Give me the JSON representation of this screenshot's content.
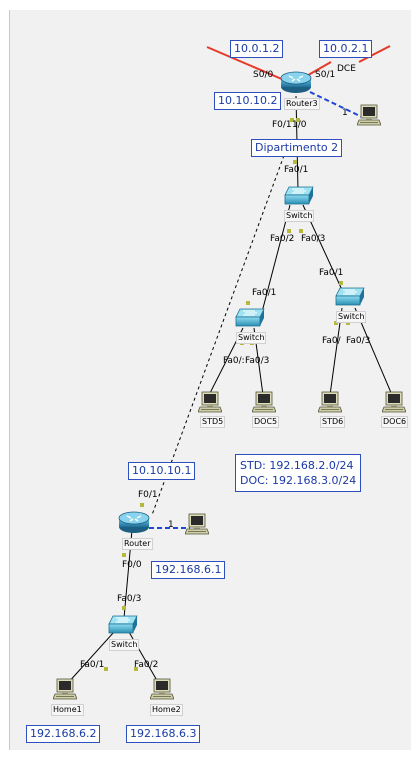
{
  "devices": {
    "router3": {
      "name": "Router3"
    },
    "router": {
      "name": "Router"
    },
    "switch_d2": {
      "name": "Switch"
    },
    "switch_left": {
      "name": "Switch"
    },
    "switch_right": {
      "name": "Switch"
    },
    "switch_bottom": {
      "name": "Switch"
    },
    "pc_r3": {
      "name": ""
    },
    "pc_router": {
      "name": ""
    },
    "std5": {
      "name": "STD5"
    },
    "doc5": {
      "name": "DOC5"
    },
    "std6": {
      "name": "STD6"
    },
    "doc6": {
      "name": "DOC6"
    },
    "home1": {
      "name": "Home1"
    },
    "home2": {
      "name": "Home2"
    }
  },
  "notes": {
    "ip_r3_s00": "10.0.1.2",
    "ip_r3_s01": "10.0.2.1",
    "ip_r3_f01": "10.10.10.2",
    "dept": "Dipartimento 2",
    "ip_router_f01": "10.10.10.1",
    "ip_router_f00": "192.168.6.1",
    "vlan_std": "STD: 192.168.2.0/24",
    "vlan_doc": "DOC: 192.168.3.0/24",
    "ip_home1": "192.168.6.2",
    "ip_home2": "192.168.6.3"
  },
  "ports": {
    "r3_s00": "S0/0",
    "r3_s01": "S0/1",
    "r3_dce": "DCE",
    "r3_f01": "F0/1",
    "r3_f10": "1/0",
    "r3_console": "1",
    "sw_d2_up": "Fa0/1",
    "sw_d2_left": "Fa0/2",
    "sw_d2_right": "Fa0/3",
    "swl_up": "Fa0/1",
    "swl_left": "Fa0/:",
    "swl_right": "Fa0/3",
    "swr_up": "Fa0/1",
    "swr_left": "Fa0/",
    "swr_right": "Fa0/3",
    "router_f01": "F0/1",
    "router_console": "1",
    "router_f00": "F0/0",
    "swb_up": "Fa0/3",
    "swb_left": "Fa0/1",
    "swb_right": "Fa0/2"
  },
  "colors": {
    "serial": "#e53a2a",
    "console": "#1f47d6",
    "straight": "#000000",
    "cross": "#000000",
    "note_border": "#2d4fbf",
    "note_text": "#1a3aa6",
    "router": "#2e8cb6",
    "switch": "#2fa6c6",
    "port_led": "#b5b83a",
    "workspace": "#f1f1f1"
  },
  "icons": {
    "router": "router-icon",
    "switch": "switch-icon",
    "pc": "pc-icon"
  }
}
